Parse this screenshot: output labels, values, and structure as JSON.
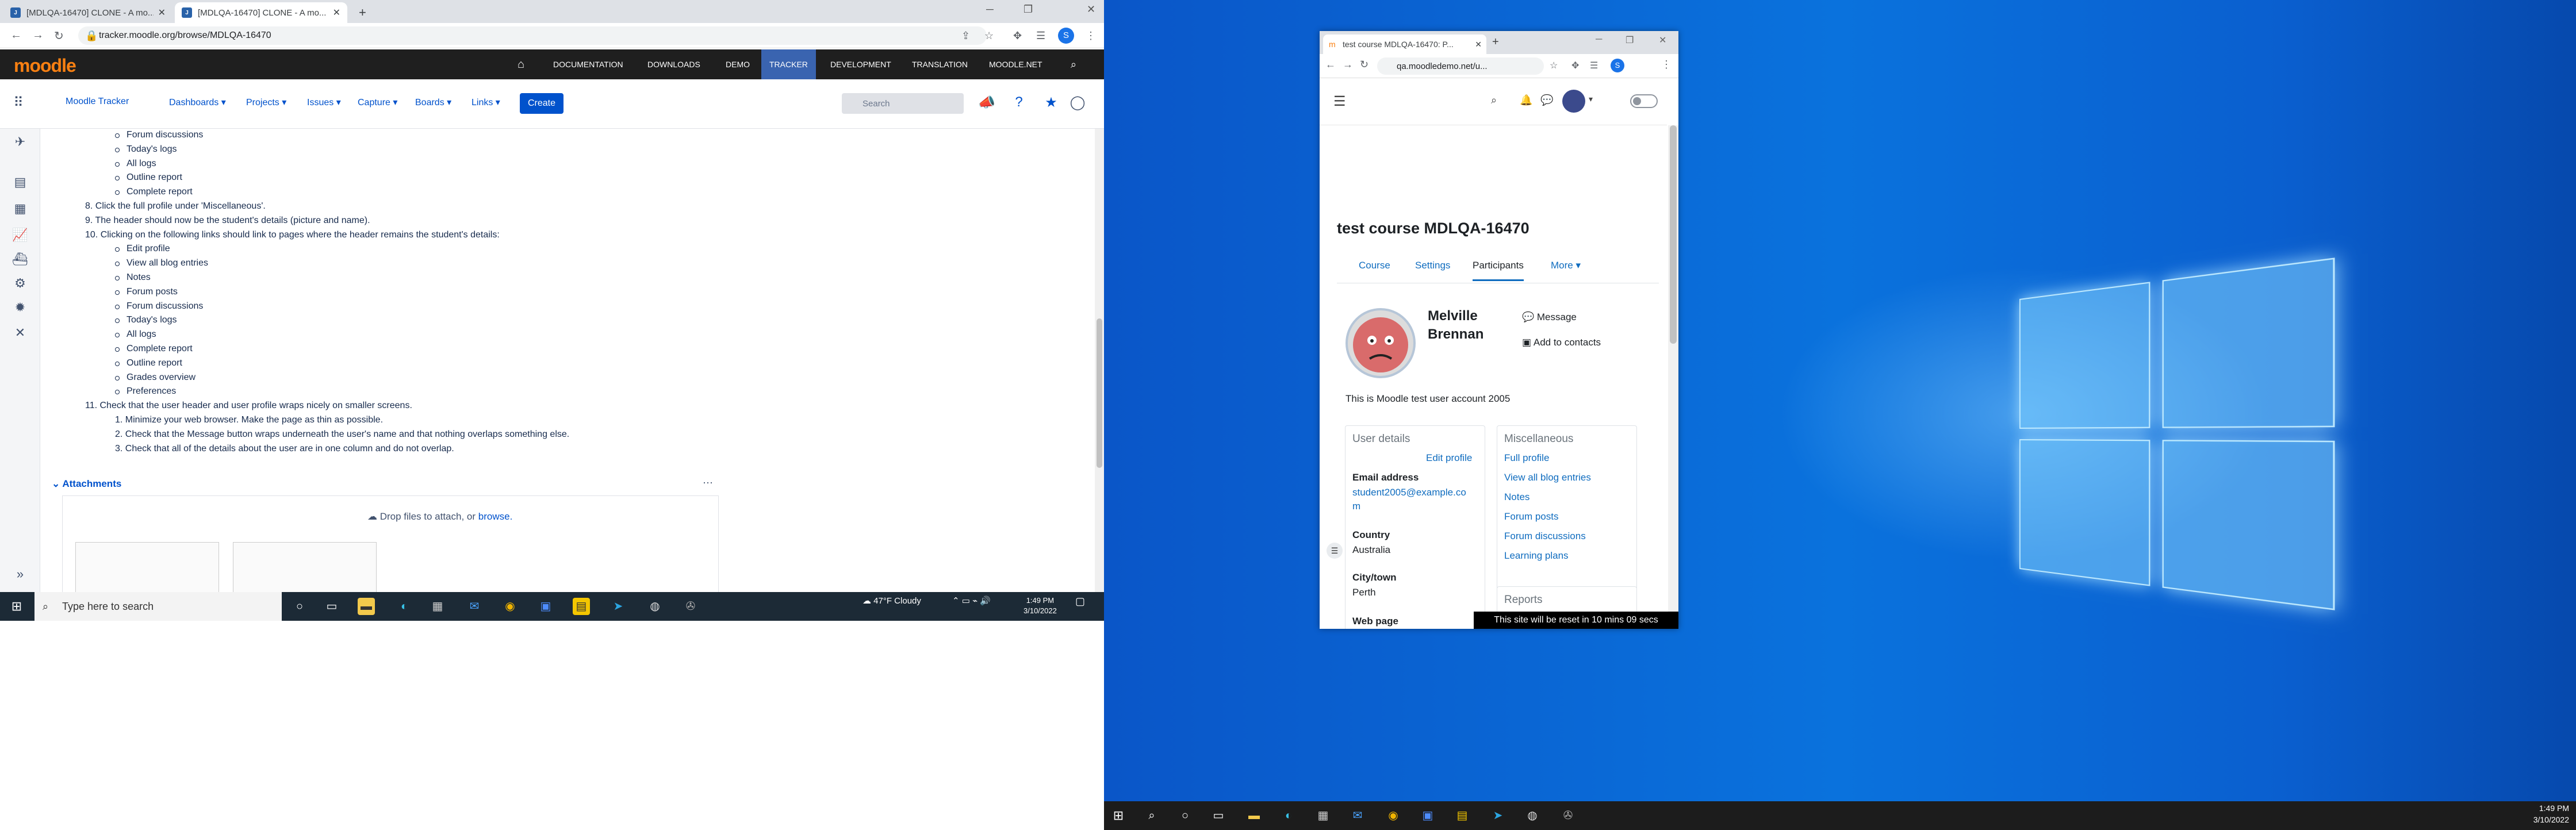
{
  "left_browser": {
    "tabs": [
      {
        "title": "[MDLQA-16470] CLONE - A mo..."
      },
      {
        "title": "[MDLQA-16470] CLONE - A mo..."
      }
    ],
    "url": "tracker.moodle.org/browse/MDLQA-16470",
    "moodle_nav": {
      "logo": "moodle",
      "links": [
        "DOCUMENTATION",
        "DOWNLOADS",
        "DEMO",
        "TRACKER",
        "DEVELOPMENT",
        "TRANSLATION",
        "MOODLE.NET"
      ],
      "active": "TRACKER"
    },
    "jira_nav": {
      "project": "Moodle Tracker",
      "menus": [
        "Dashboards ▾",
        "Projects ▾",
        "Issues ▾",
        "Capture ▾",
        "Boards ▾",
        "Links ▾"
      ],
      "create": "Create",
      "search_placeholder": "Search"
    },
    "content_lines": [
      {
        "text": "Forum discussions",
        "type": "bullet"
      },
      {
        "text": "Today's logs",
        "type": "bullet"
      },
      {
        "text": "All logs",
        "type": "bullet"
      },
      {
        "text": "Outline report",
        "type": "bullet"
      },
      {
        "text": "Complete report",
        "type": "bullet"
      },
      {
        "text": "8. Click the full profile under 'Miscellaneous'.",
        "type": "num"
      },
      {
        "text": "9. The header should now be the student's details (picture and name).",
        "type": "num"
      },
      {
        "text": "10. Clicking on the following links should link to pages where the header remains the student's details:",
        "type": "num"
      },
      {
        "text": "Edit profile",
        "type": "bullet"
      },
      {
        "text": "View all blog entries",
        "type": "bullet"
      },
      {
        "text": "Notes",
        "type": "bullet"
      },
      {
        "text": "Forum posts",
        "type": "bullet"
      },
      {
        "text": "Forum discussions",
        "type": "bullet"
      },
      {
        "text": "Today's logs",
        "type": "bullet"
      },
      {
        "text": "All logs",
        "type": "bullet"
      },
      {
        "text": "Complete report",
        "type": "bullet"
      },
      {
        "text": "Outline report",
        "type": "bullet"
      },
      {
        "text": "Grades overview",
        "type": "bullet"
      },
      {
        "text": "Preferences",
        "type": "bullet"
      },
      {
        "text": "11. Check that the user header and user profile wraps nicely on smaller screens.",
        "type": "num"
      },
      {
        "text": "1. Minimize your web browser. Make the page as thin as possible.",
        "type": "sub"
      },
      {
        "text": "2. Check that the Message button wraps underneath the user's name and that nothing overlaps something else.",
        "type": "sub"
      },
      {
        "text": "3. Check that all of the details about the user are in one column and do not overlap.",
        "type": "sub"
      }
    ],
    "attachments": {
      "label": "Attachments",
      "drop_text": "Drop files to attach, or",
      "browse": "browse."
    }
  },
  "left_taskbar": {
    "search_placeholder": "Type here to search",
    "weather": "47°F Cloudy",
    "time": "1:49 PM",
    "date": "3/10/2022"
  },
  "small_browser": {
    "tab_title": "test course MDLQA-16470: P...",
    "url": "qa.moodledemo.net/u...",
    "course_title": "test course MDLQA-16470",
    "nav": [
      "Course",
      "Settings",
      "Participants",
      "More ▾"
    ],
    "active_nav": "Participants",
    "user": {
      "first": "Melville",
      "last": "Brennan",
      "message": "Message",
      "add_contact": "Add to contacts",
      "description": "This is Moodle test user account 2005"
    },
    "user_details": {
      "title": "User details",
      "edit": "Edit profile",
      "email_label": "Email address",
      "email_line1": "student2005@example.co",
      "email_line2": "m",
      "country_label": "Country",
      "country": "Australia",
      "city_label": "City/town",
      "city": "Perth",
      "web_label": "Web page"
    },
    "misc": {
      "title": "Miscellaneous",
      "links": [
        "Full profile",
        "View all blog entries",
        "Notes",
        "Forum posts",
        "Forum discussions",
        "Learning plans"
      ],
      "reports": "Reports"
    },
    "reset_notice": "This site will be reset in 10 mins 09 secs"
  },
  "desktop_taskbar": {
    "time": "1:49 PM",
    "date": "3/10/2022"
  }
}
